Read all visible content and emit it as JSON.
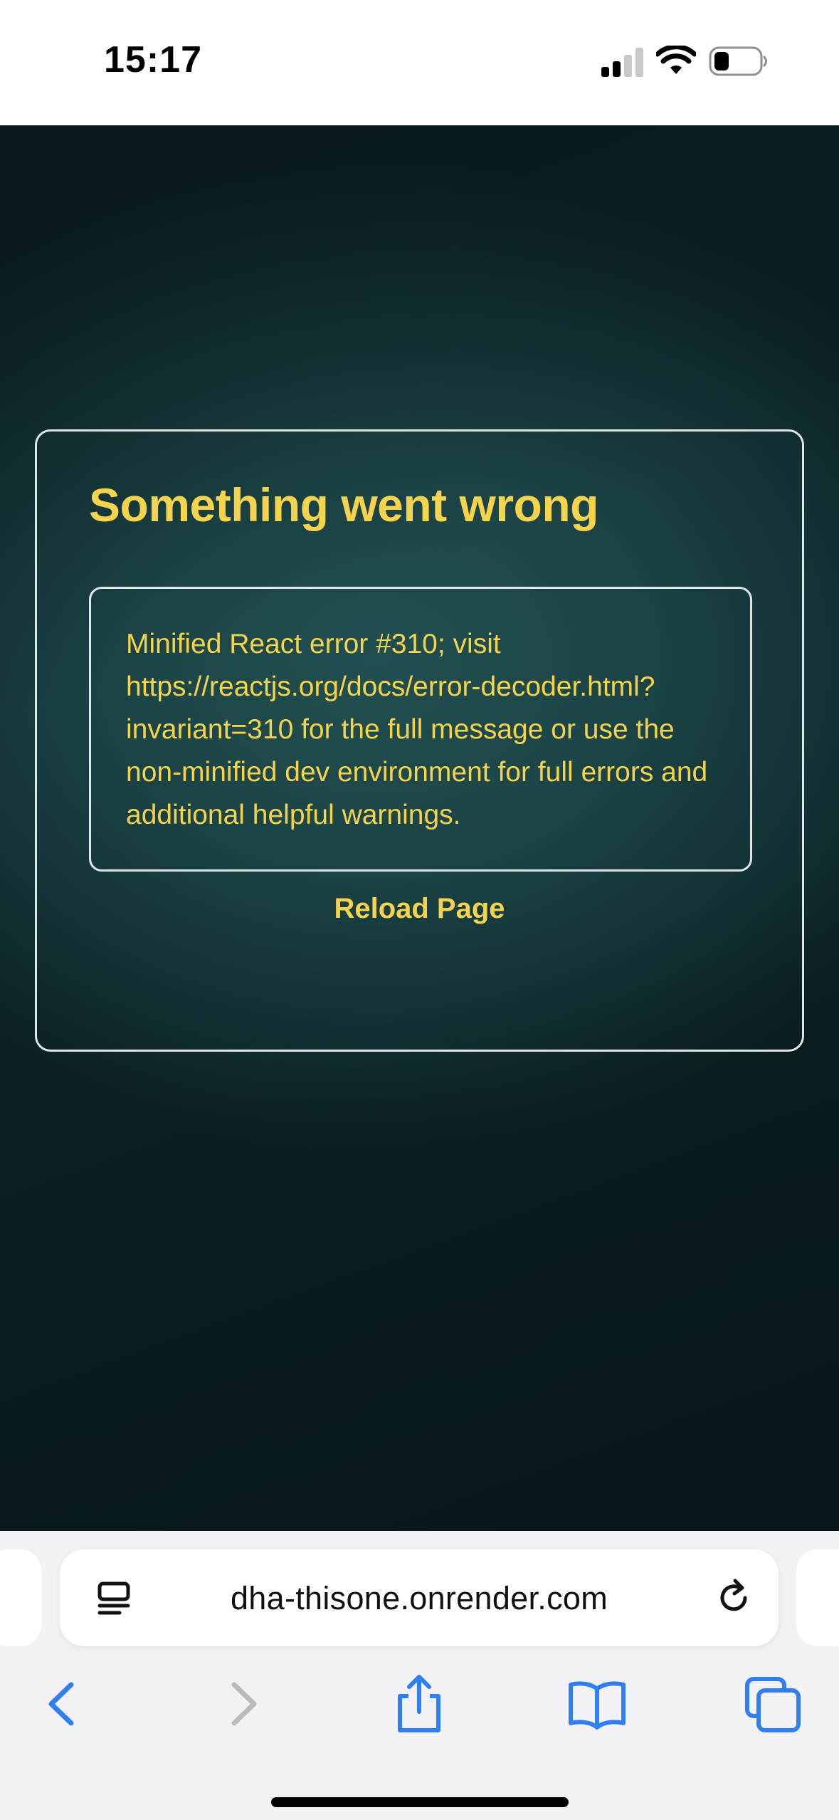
{
  "status_bar": {
    "time": "15:17"
  },
  "page": {
    "title": "Something went wrong",
    "error_message": "Minified React error #310; visit https://reactjs.org/docs/error-decoder.html?invariant=310 for the full message or use the non-minified dev environment for full errors and additional helpful warnings.",
    "reload_label": "Reload Page"
  },
  "browser": {
    "url": "dha-thisone.onrender.com"
  },
  "colors": {
    "accent_text": "#f4d44c",
    "background": "#1c4446",
    "safari_blue": "#2f7ff0"
  }
}
